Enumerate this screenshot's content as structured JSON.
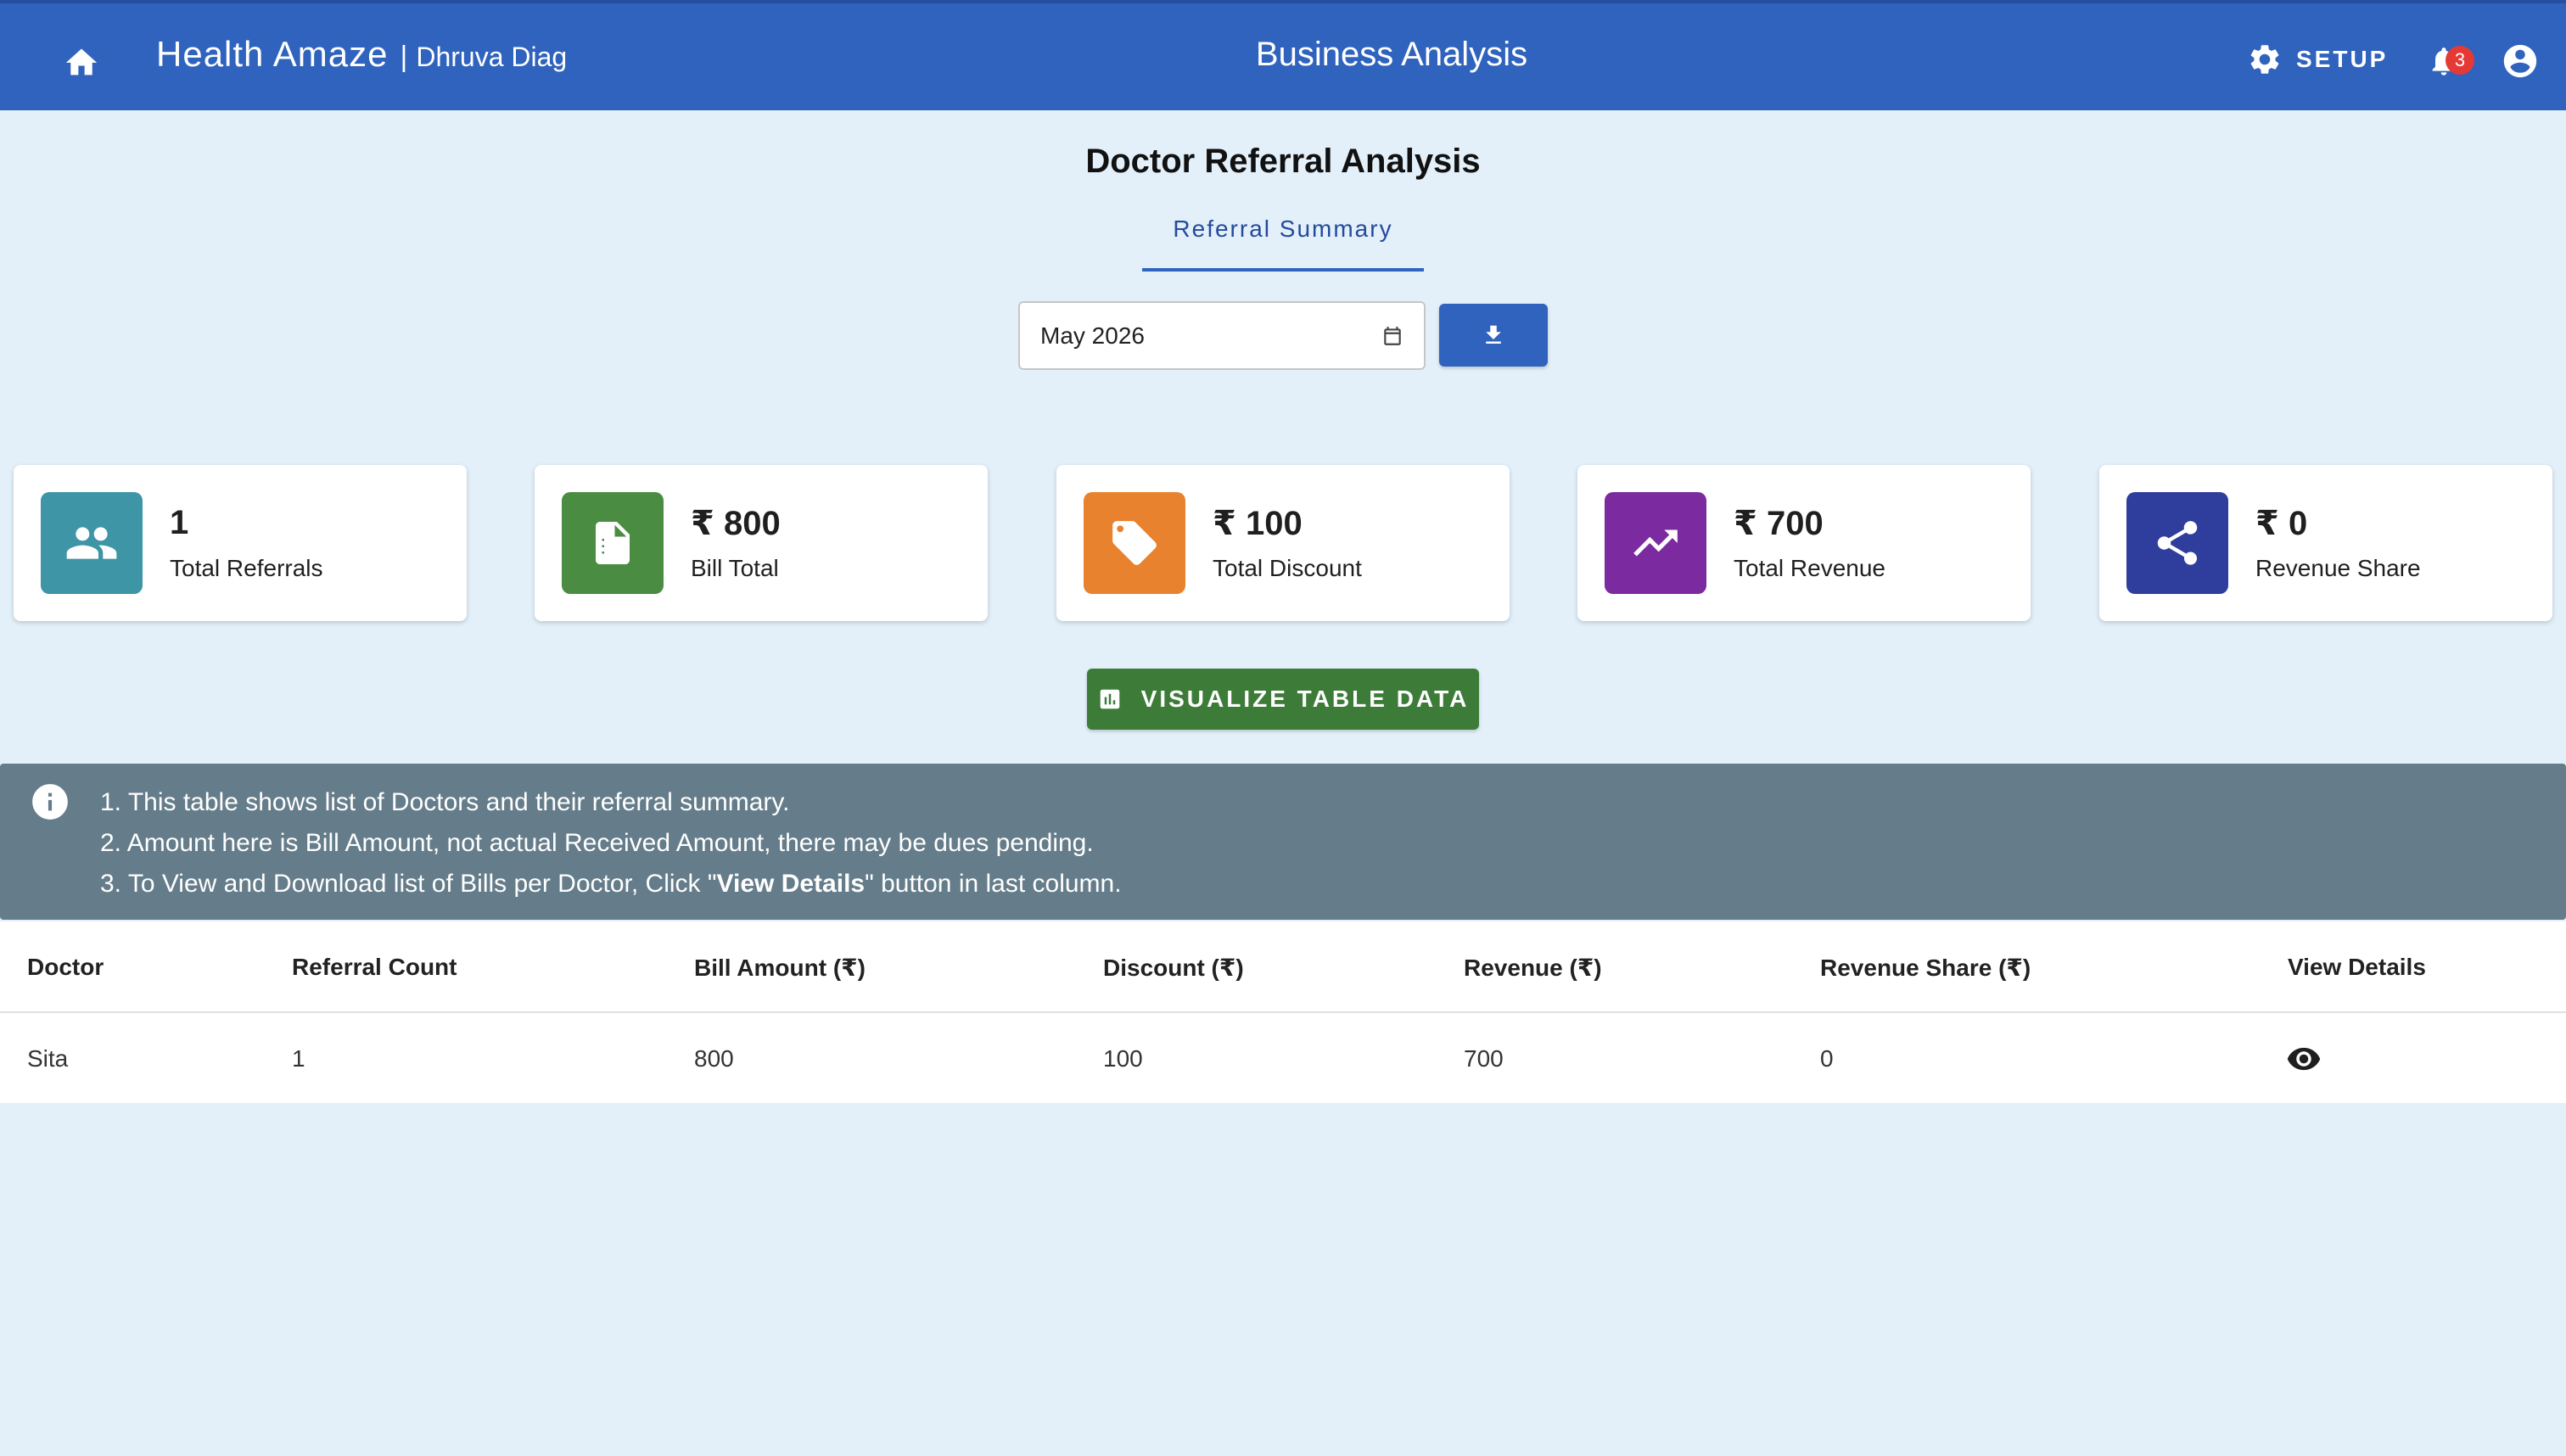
{
  "appbar": {
    "app_name": "Health Amaze",
    "separator": "|",
    "org_name": "Dhruva Diag",
    "page_title": "Business Analysis",
    "setup_label": "SETUP",
    "notification_count": "3"
  },
  "page": {
    "heading": "Doctor Referral Analysis",
    "tab_label": "Referral Summary"
  },
  "filter": {
    "month_value": "May 2026"
  },
  "stats": [
    {
      "value": "1",
      "label": "Total Referrals",
      "icon": "group-icon",
      "color": "#3d95a6"
    },
    {
      "value": "₹ 800",
      "label": "Bill Total",
      "icon": "bill-icon",
      "color": "#4a8c42"
    },
    {
      "value": "₹ 100",
      "label": "Total Discount",
      "icon": "tag-icon",
      "color": "#e8822e"
    },
    {
      "value": "₹ 700",
      "label": "Total Revenue",
      "icon": "trending-up-icon",
      "color": "#7b2aa0"
    },
    {
      "value": "₹ 0",
      "label": "Revenue Share",
      "icon": "share-icon",
      "color": "#2f3d9c"
    }
  ],
  "visualize_label": "VISUALIZE TABLE DATA",
  "info": {
    "line1": "1. This table shows list of Doctors and their referral summary.",
    "line2": "2. Amount here is Bill Amount, not actual Received Amount, there may be dues pending.",
    "line3_prefix": "3. To View and Download list of Bills per Doctor, Click \"",
    "line3_bold": "View Details",
    "line3_suffix": "\" button in last column."
  },
  "table": {
    "headers": [
      "Doctor",
      "Referral Count",
      "Bill Amount (₹)",
      "Discount (₹)",
      "Revenue (₹)",
      "Revenue Share (₹)",
      "View Details"
    ],
    "rows": [
      [
        "Sita",
        "1",
        "800",
        "100",
        "700",
        "0"
      ]
    ]
  },
  "colors": {
    "appbar": "#2f63bd",
    "background": "#e3f0fa",
    "visualize_button": "#3d7c38",
    "info_banner": "#657d8a"
  }
}
